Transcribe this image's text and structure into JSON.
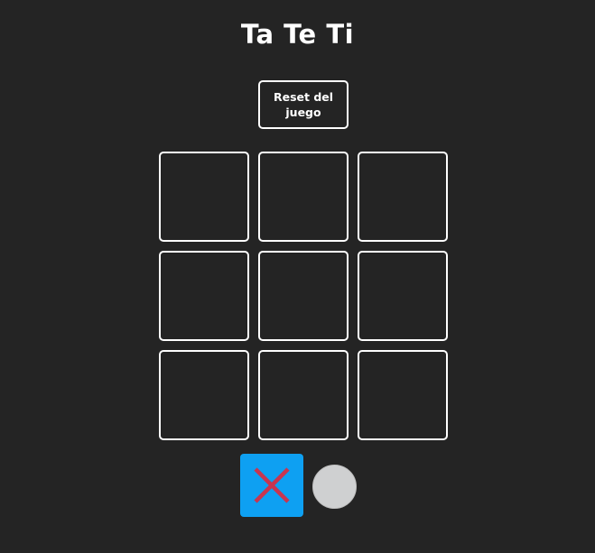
{
  "header": {
    "title": "Ta Te Ti"
  },
  "controls": {
    "reset_label": "Reset del juego"
  },
  "board": {
    "cells": [
      "",
      "",
      "",
      "",
      "",
      "",
      "",
      "",
      ""
    ]
  },
  "turn_indicator": {
    "current_player": "X",
    "players": [
      {
        "symbol": "x-icon",
        "active": true
      },
      {
        "symbol": "o-icon",
        "active": false
      }
    ],
    "active_color": "#0ea0f2",
    "x_color": "#c83550",
    "o_color": "#cfd0d1"
  },
  "colors": {
    "background": "#242424",
    "foreground": "#ffffff"
  }
}
